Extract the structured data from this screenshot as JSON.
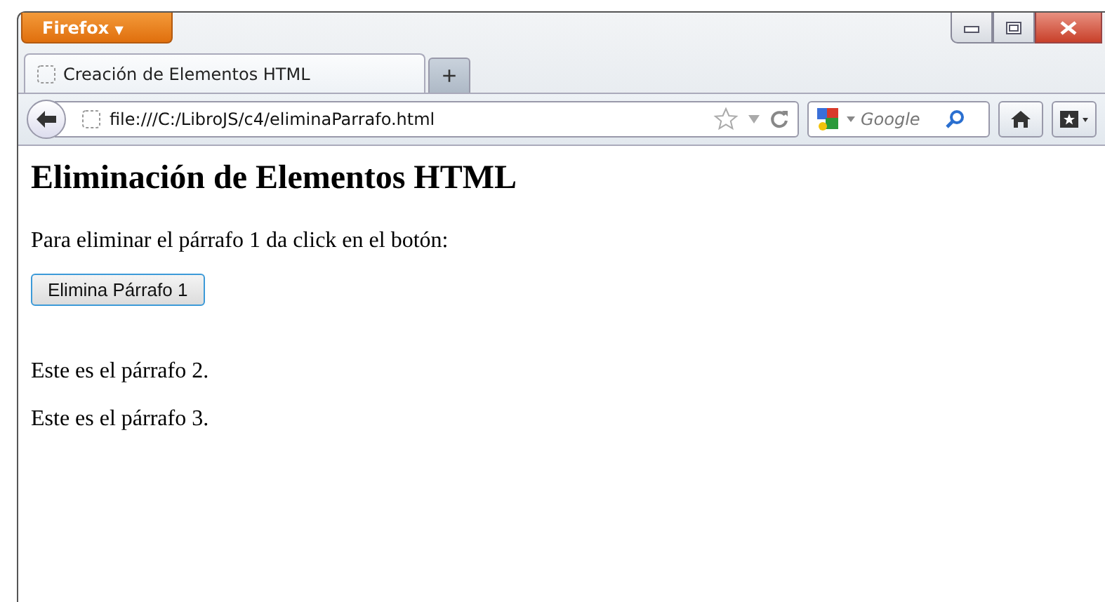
{
  "app_menu": {
    "label": "Firefox",
    "symbol": "▼"
  },
  "tabs": [
    {
      "title": "Creación de Elementos HTML",
      "selected": true
    }
  ],
  "new_tab": {
    "label": "+"
  },
  "address": {
    "value": "file:///C:/LibroJS/c4/eliminaParrafo.html"
  },
  "search": {
    "placeholder": "Google"
  },
  "page": {
    "heading": "Eliminación de Elementos HTML",
    "intro": "Para eliminar el párrafo 1 da click en el botón:",
    "button": "Elimina Párrafo 1",
    "paragraphs": [
      "Este es el párrafo 2.",
      "Este es el párrafo 3."
    ]
  }
}
